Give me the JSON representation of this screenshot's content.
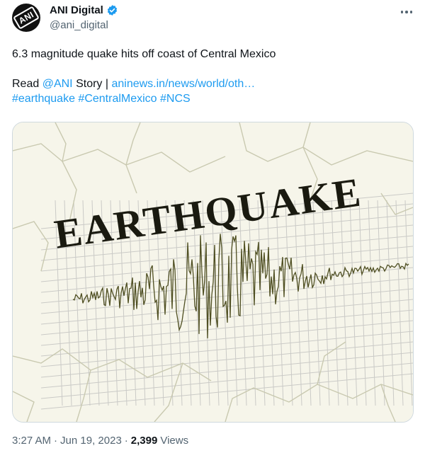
{
  "author": {
    "display_name": "ANI Digital",
    "handle": "@ani_digital",
    "avatar_text": "ANI"
  },
  "tweet": {
    "headline": "6.3 magnitude quake hits off coast of Central Mexico",
    "read_prefix": "Read ",
    "mention": "@ANI",
    "story_text": " Story | ",
    "link_text": "aninews.in/news/world/oth…",
    "hashtags": [
      "#earthquake",
      "#CentralMexico",
      "#NCS"
    ]
  },
  "media": {
    "title_text": "EARTHQUAKE",
    "colors": {
      "ink": "#1a1a10",
      "wave": "#4f4f22",
      "paper": "#f6f5ea",
      "crack": "#c9c9b0",
      "grid": "#b8b8b8"
    }
  },
  "meta": {
    "time": "3:27 AM",
    "separator": "·",
    "date": "Jun 19, 2023",
    "views_count": "2,399",
    "views_label": "Views"
  },
  "icons": {
    "verified": "verified-badge-icon",
    "more": "more-options-icon"
  }
}
